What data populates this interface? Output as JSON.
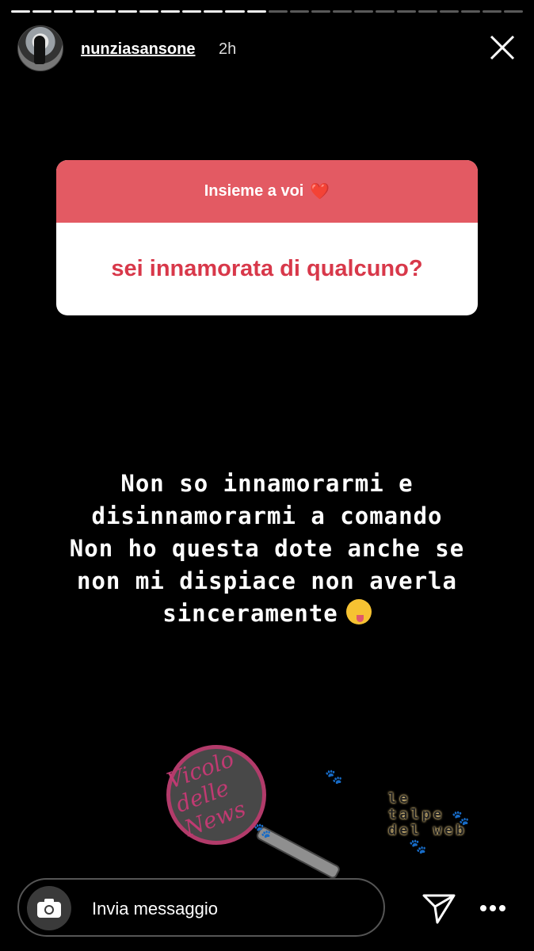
{
  "story": {
    "progress_segments_total": 24,
    "progress_segments_done": 12
  },
  "header": {
    "username": "nunziasansone",
    "time": "2h",
    "close_icon": "close-icon"
  },
  "question": {
    "title": "Insieme a voi",
    "title_emoji": "❤️",
    "text": "sei innamorata di qualcuno?",
    "accent_color": "#e35a63"
  },
  "answer": {
    "lines": [
      "Non so innamorarmi e",
      "disinnamorarmi a comando",
      "Non ho questa dote anche se",
      "non mi dispiace non averla",
      "sinceramente"
    ],
    "emoji": "winking-face-with-tongue"
  },
  "watermark": {
    "logo_text": "Vicolo delle News",
    "text": "le talpe del web"
  },
  "composer": {
    "placeholder": "Invia messaggio",
    "camera_icon": "camera-icon",
    "send_icon": "send-icon",
    "more_icon": "more-icon"
  }
}
